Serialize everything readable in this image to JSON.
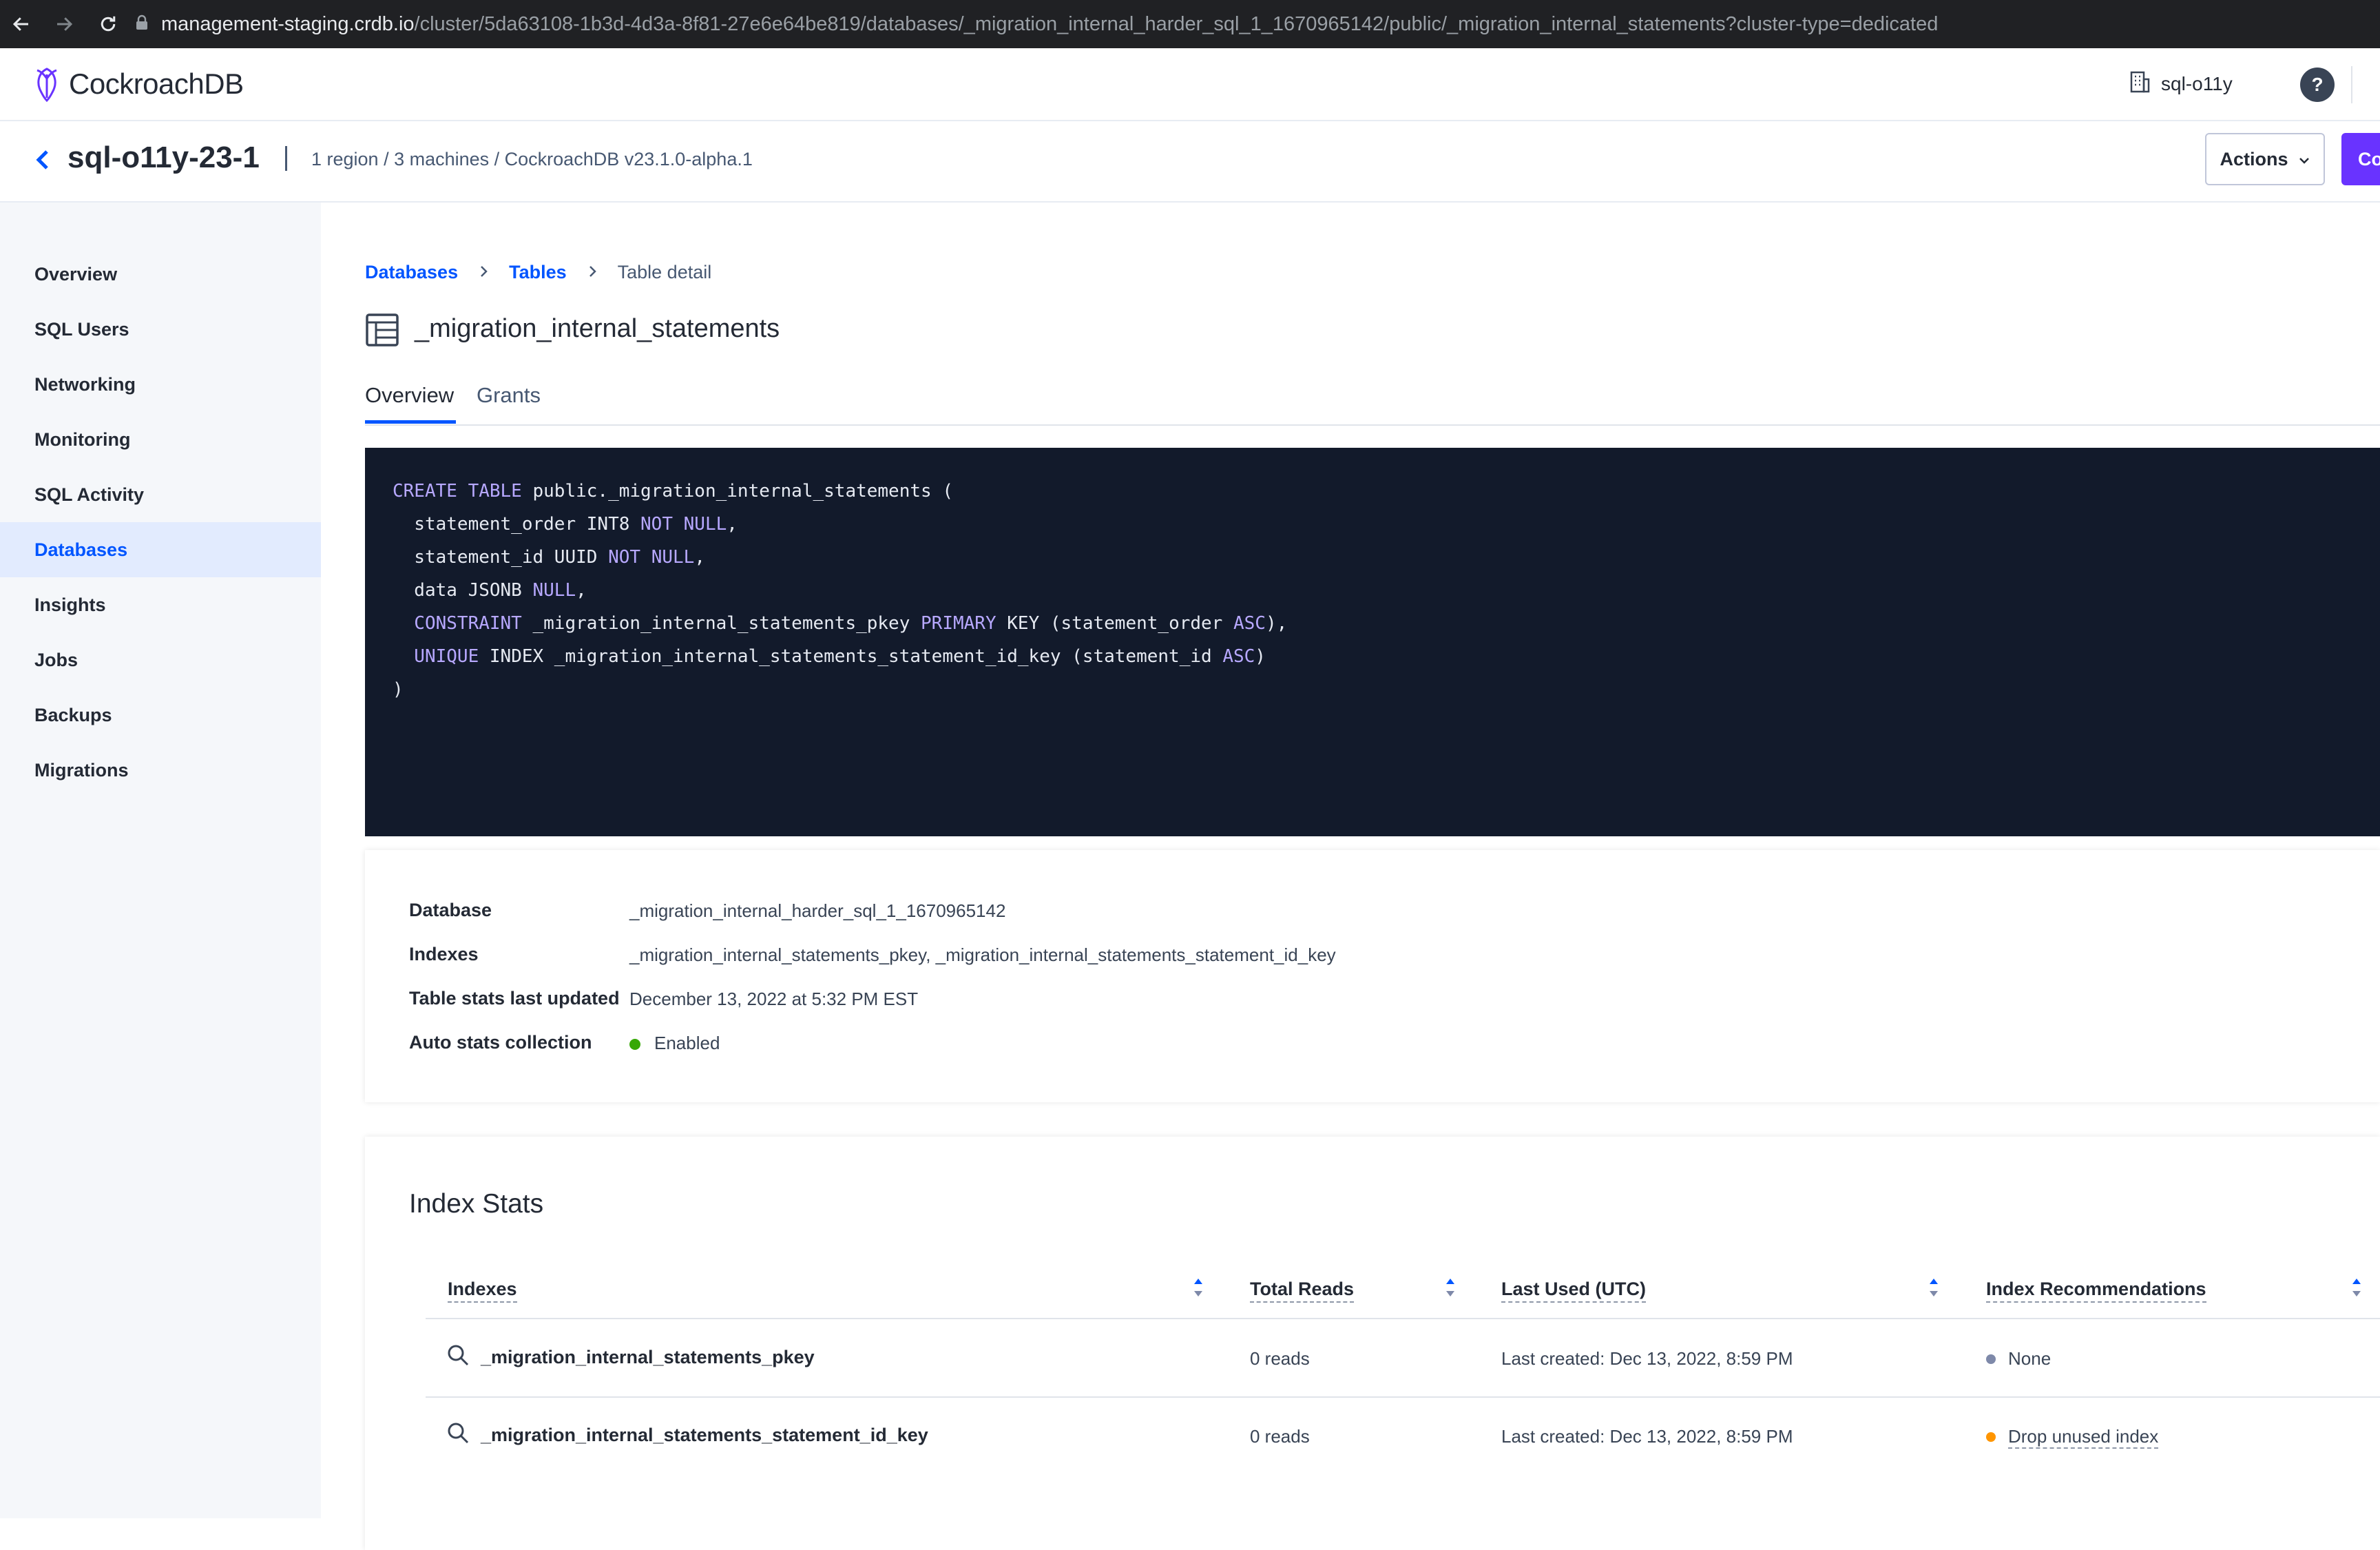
{
  "browser": {
    "url_host": "management-staging.crdb.io",
    "url_path": "/cluster/5da63108-1b3d-4d3a-8f81-27e6e64be819/databases/_migration_internal_harder_sql_1_1670965142/public/_migration_internal_statements?cluster-type=dedicated"
  },
  "header": {
    "logo_text": "CockroachDB",
    "org_name": "sql-o11y",
    "help_label": "?"
  },
  "cluster": {
    "name": "sql-o11y-23-1",
    "meta": "1 region / 3 machines / CockroachDB  v23.1.0-alpha.1",
    "actions_label": "Actions",
    "connect_label": "Co"
  },
  "sidebar": {
    "items": [
      {
        "label": "Overview"
      },
      {
        "label": "SQL Users"
      },
      {
        "label": "Networking"
      },
      {
        "label": "Monitoring"
      },
      {
        "label": "SQL Activity"
      },
      {
        "label": "Databases"
      },
      {
        "label": "Insights"
      },
      {
        "label": "Jobs"
      },
      {
        "label": "Backups"
      },
      {
        "label": "Migrations"
      }
    ],
    "active_index": 5
  },
  "breadcrumb": {
    "databases": "Databases",
    "tables": "Tables",
    "current": "Table detail"
  },
  "page": {
    "title": "_migration_internal_statements"
  },
  "tabs": {
    "overview": "Overview",
    "grants": "Grants"
  },
  "sql": {
    "l1_kw": "CREATE TABLE",
    "l1_rest": " public._migration_internal_statements (",
    "l2_a": "  statement_order INT8 ",
    "l2_kw": "NOT NULL",
    "l2_b": ",",
    "l3_a": "  statement_id UUID ",
    "l3_kw": "NOT NULL",
    "l3_b": ",",
    "l4_a": "  data JSONB ",
    "l4_kw": "NULL",
    "l4_b": ",",
    "l5_kw1": "  CONSTRAINT",
    "l5_a": " _migration_internal_statements_pkey ",
    "l5_kw2": "PRIMARY",
    "l5_b": " KEY (statement_order ",
    "l5_kw3": "ASC",
    "l5_c": "),",
    "l6_kw1": "  UNIQUE",
    "l6_a": " INDEX _migration_internal_statements_statement_id_key (statement_id ",
    "l6_kw2": "ASC",
    "l6_b": ")",
    "l7": ")"
  },
  "summary": {
    "database_label": "Database",
    "database_value": "_migration_internal_harder_sql_1_1670965142",
    "indexes_label": "Indexes",
    "indexes_value": "_migration_internal_statements_pkey, _migration_internal_statements_statement_id_key",
    "stats_updated_label": "Table stats last updated",
    "stats_updated_value": "December 13, 2022 at 5:32 PM EST",
    "auto_stats_label": "Auto stats collection",
    "auto_stats_value": "Enabled",
    "auto_stats_color": "#37a806"
  },
  "index_stats": {
    "title": "Index Stats",
    "columns": {
      "indexes": "Indexes",
      "total_reads": "Total Reads",
      "last_used": "Last Used (UTC)",
      "recommendations": "Index Recommendations"
    },
    "rows": [
      {
        "name": "_migration_internal_statements_pkey",
        "reads": "0 reads",
        "last_used": "Last created: Dec 13, 2022, 8:59 PM",
        "recommendation": "None",
        "rec_color": "#7e89a9"
      },
      {
        "name": "_migration_internal_statements_statement_id_key",
        "reads": "0 reads",
        "last_used": "Last created: Dec 13, 2022, 8:59 PM",
        "recommendation": "Drop unused index",
        "rec_color": "#ff9500"
      }
    ]
  }
}
